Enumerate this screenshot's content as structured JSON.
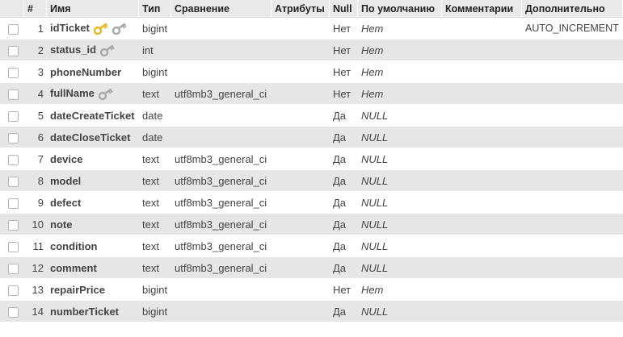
{
  "headers": {
    "hash": "#",
    "name": "Имя",
    "type": "Тип",
    "collation": "Сравнение",
    "attributes": "Атрибуты",
    "null": "Null",
    "default": "По умолчанию",
    "comments": "Комментарии",
    "extra": "Дополнительно"
  },
  "rows": [
    {
      "num": "1",
      "name": "idTicket",
      "type": "bigint",
      "collation": "",
      "null": "Нет",
      "default": "Нет",
      "extra": "AUTO_INCREMENT",
      "icons": [
        "primary-key-icon",
        "index-key-icon"
      ]
    },
    {
      "num": "2",
      "name": "status_id",
      "type": "int",
      "collation": "",
      "null": "Нет",
      "default": "Нет",
      "extra": "",
      "icons": [
        "index-key-icon"
      ]
    },
    {
      "num": "3",
      "name": "phoneNumber",
      "type": "bigint",
      "collation": "",
      "null": "Нет",
      "default": "Нет",
      "extra": "",
      "icons": []
    },
    {
      "num": "4",
      "name": "fullName",
      "type": "text",
      "collation": "utf8mb3_general_ci",
      "null": "Нет",
      "default": "Нет",
      "extra": "",
      "icons": [
        "index-key-icon"
      ]
    },
    {
      "num": "5",
      "name": "dateCreateTicket",
      "type": "date",
      "collation": "",
      "null": "Да",
      "default": "NULL",
      "extra": "",
      "icons": []
    },
    {
      "num": "6",
      "name": "dateCloseTicket",
      "type": "date",
      "collation": "",
      "null": "Да",
      "default": "NULL",
      "extra": "",
      "icons": []
    },
    {
      "num": "7",
      "name": "device",
      "type": "text",
      "collation": "utf8mb3_general_ci",
      "null": "Да",
      "default": "NULL",
      "extra": "",
      "icons": []
    },
    {
      "num": "8",
      "name": "model",
      "type": "text",
      "collation": "utf8mb3_general_ci",
      "null": "Да",
      "default": "NULL",
      "extra": "",
      "icons": []
    },
    {
      "num": "9",
      "name": "defect",
      "type": "text",
      "collation": "utf8mb3_general_ci",
      "null": "Да",
      "default": "NULL",
      "extra": "",
      "icons": []
    },
    {
      "num": "10",
      "name": "note",
      "type": "text",
      "collation": "utf8mb3_general_ci",
      "null": "Да",
      "default": "NULL",
      "extra": "",
      "icons": []
    },
    {
      "num": "11",
      "name": "condition",
      "type": "text",
      "collation": "utf8mb3_general_ci",
      "null": "Да",
      "default": "NULL",
      "extra": "",
      "icons": []
    },
    {
      "num": "12",
      "name": "comment",
      "type": "text",
      "collation": "utf8mb3_general_ci",
      "null": "Да",
      "default": "NULL",
      "extra": "",
      "icons": []
    },
    {
      "num": "13",
      "name": "repairPrice",
      "type": "bigint",
      "collation": "",
      "null": "Нет",
      "default": "Нет",
      "extra": "",
      "icons": []
    },
    {
      "num": "14",
      "name": "numberTicket",
      "type": "bigint",
      "collation": "",
      "null": "Да",
      "default": "NULL",
      "extra": "",
      "icons": []
    }
  ],
  "colors": {
    "header_bg": "#e9e9e9",
    "row_alt_bg": "#e6e6e6",
    "primary_key": "#e8b422",
    "index_key": "#a9a9a9"
  }
}
